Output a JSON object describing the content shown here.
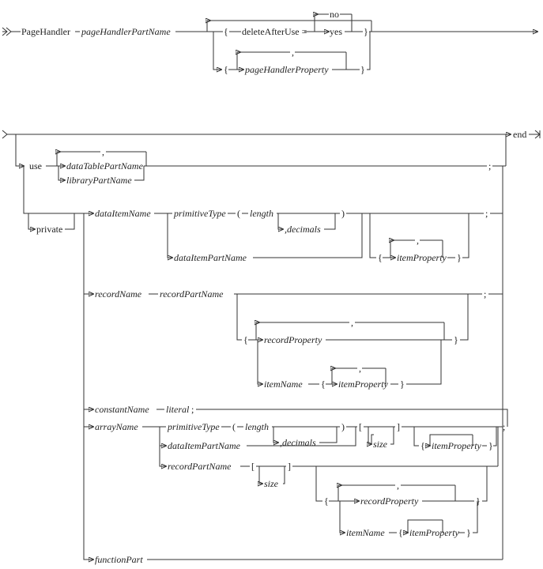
{
  "chart_data": {
    "type": "table",
    "description": "Railroad syntax diagram for PageHandler declaration",
    "title": "",
    "xlabel": "",
    "ylabel": ""
  },
  "head": {
    "pageHandler": "PageHandler",
    "pageHandlerPartName": "pageHandlerPartName",
    "deleteAfterUse": "deleteAfterUse =",
    "no": "no",
    "yes": "yes",
    "pageHandlerProperty": "pageHandlerProperty",
    "lbrace": "{",
    "rbrace": "}",
    "comma": ","
  },
  "body": {
    "end": "end",
    "use": "use",
    "dataTablePartName": "dataTablePartName",
    "libraryPartName": "libraryPartName",
    "private": "private",
    "dataItemName": "dataItemName",
    "primitiveType": "primitiveType",
    "lparen": "(",
    "rparen": ")",
    "length": "length",
    "decimals": ",decimals",
    "dataItemPartName": "dataItemPartName",
    "itemProperty": "itemProperty",
    "recordName": "recordName",
    "recordPartName": "recordPartName",
    "recordProperty": "recordProperty",
    "itemName": "itemName",
    "constantName": "constantName",
    "literal": "literal",
    "arrayName": "arrayName",
    "size": "size",
    "lbracket": "[",
    "rbracket": "]",
    "functionPart": "functionPart",
    "semi": ";",
    "lbrace": "{",
    "rbrace": "}",
    "comma": ","
  }
}
